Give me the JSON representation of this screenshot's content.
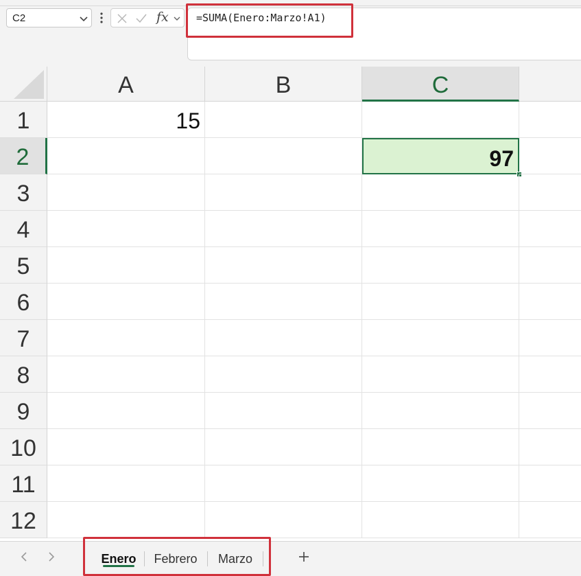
{
  "formula_bar": {
    "name_box": "C2",
    "formula": "=SUMA(Enero:Marzo!A1)",
    "fx_label": "fx"
  },
  "grid": {
    "columns": [
      "A",
      "B",
      "C"
    ],
    "rows": [
      "1",
      "2",
      "3",
      "4",
      "5",
      "6",
      "7",
      "8",
      "9",
      "10",
      "11",
      "12"
    ],
    "cells": {
      "A1": "15",
      "C2": "97"
    },
    "selected_cell": "C2"
  },
  "sheets": {
    "tabs": [
      "Enero",
      "Febrero",
      "Marzo"
    ],
    "active": "Enero"
  },
  "colors": {
    "accent": "#217346",
    "highlight": "#d0313b",
    "selected_fill": "#dbf2d2"
  }
}
